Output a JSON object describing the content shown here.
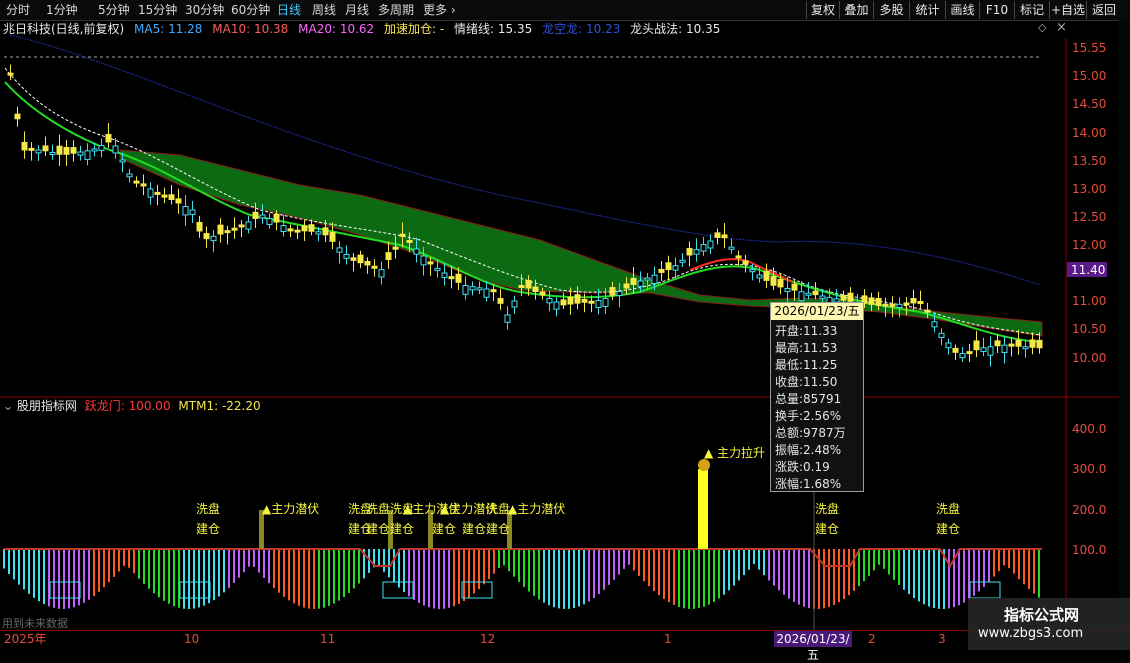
{
  "toolbar": {
    "timeframes": [
      "分时",
      "1分钟",
      "5分钟",
      "15分钟",
      "30分钟",
      "60分钟",
      "日线",
      "周线",
      "月线",
      "多周期",
      "更多"
    ],
    "active_timeframe": "日线",
    "right_buttons": [
      "复权",
      "叠加",
      "多股",
      "统计",
      "画线",
      "F10",
      "标记",
      "+自选",
      "返回"
    ]
  },
  "info": {
    "title": "兆日科技(日线,前复权)",
    "ma5": "MA5: 11.28",
    "ma10": "MA10: 10.38",
    "ma20": "MA20: 10.62",
    "jiasu": "加速加仓: -",
    "qingxu": "情绪线: 15.35",
    "longkong": "龙空龙: 10.23",
    "longtou": "龙头战法: 10.35"
  },
  "price_axis": {
    "labels": [
      "15.55",
      "15.00",
      "14.50",
      "14.00",
      "13.50",
      "13.00",
      "12.50",
      "12.00",
      "11.50",
      "11.00",
      "10.50",
      "10.00"
    ],
    "current_price": "11.40"
  },
  "indicator": {
    "title": "股朋指标网",
    "yuelongmen": "跃龙门: 100.00",
    "mtm1": "MTM1: -22.20",
    "axis_labels": [
      "400.0",
      "300.0",
      "200.0",
      "100.0"
    ],
    "signals": {
      "xipan": "洗盘",
      "jiancang": "建仓",
      "zhuli_qianfu": "主力潜伏",
      "zhuli_lasheng": "主力拉升"
    }
  },
  "tooltip": {
    "date": "2026/01/23/五",
    "rows": [
      "开盘:11.33",
      "最高:11.53",
      "最低:11.25",
      "收盘:11.50",
      "总量:85791",
      "换手:2.56%",
      "总额:9787万",
      "振幅:2.48%",
      "涨跌:0.19",
      "涨幅:1.68%"
    ]
  },
  "date_axis": {
    "labels": [
      "2025年",
      "10",
      "11",
      "12",
      "1",
      "2",
      "3"
    ],
    "cursor_date": "2026/01/23/五",
    "footnote": "用到未来数据"
  },
  "watermark": {
    "title": "指标公式网",
    "url": "www.zbgs3.com"
  },
  "colors": {
    "up": "#3fe0f0",
    "down": "#f5e84a",
    "ma5": "#ffffff",
    "ma10": "#22dd22",
    "band": "#0c6a12",
    "baseline": "#1f2fb0"
  }
}
